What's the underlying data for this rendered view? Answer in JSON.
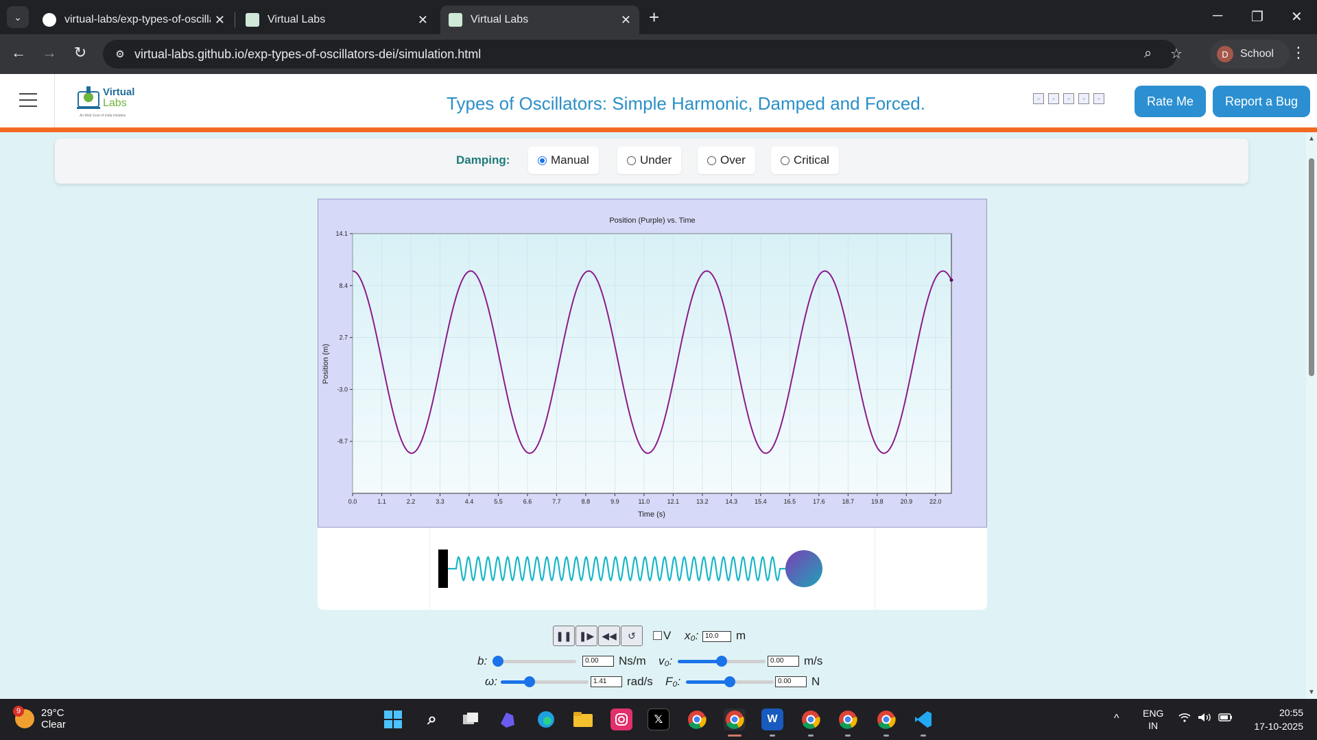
{
  "browser": {
    "tabs": [
      {
        "title": "virtual-labs/exp-types-of-oscilla",
        "favicon": "github-icon",
        "active": false
      },
      {
        "title": "Virtual Labs",
        "favicon": "virtual-labs-icon",
        "active": false
      },
      {
        "title": "Virtual Labs",
        "favicon": "virtual-labs-icon",
        "active": true
      }
    ],
    "close_glyph": "✕",
    "new_tab_glyph": "+",
    "url": "virtual-labs.github.io/exp-types-of-oscillators-dei/simulation.html",
    "profile": {
      "initial": "D",
      "label": "School"
    },
    "window_controls": [
      "─",
      "❐",
      "✕"
    ]
  },
  "header": {
    "logo_word1": "Virtual",
    "logo_word2": "Labs",
    "logo_tagline": "An MoE Govt of India Initiative",
    "title": "Types of Oscillators: Simple Harmonic, Damped and Forced.",
    "rate_button": "Rate Me",
    "bug_button": "Report a Bug"
  },
  "damping": {
    "label": "Damping:",
    "options": [
      "Manual",
      "Under",
      "Over",
      "Critical"
    ],
    "selected": "Manual"
  },
  "chart_data": {
    "type": "line",
    "title": "Position (Purple) vs. Time",
    "xlabel": "Time (s)",
    "ylabel": "Position (m)",
    "xlim": [
      0,
      22.6
    ],
    "ylim": [
      -14.4,
      14.1
    ],
    "x_ticks": [
      "0.0",
      "1.1",
      "2.2",
      "3.3",
      "4.4",
      "5.5",
      "6.6",
      "7.7",
      "8.8",
      "9.9",
      "11.0",
      "12.1",
      "13.2",
      "14.3",
      "15.4",
      "16.5",
      "17.6",
      "18.7",
      "19.8",
      "20.9",
      "22.0"
    ],
    "y_ticks": [
      {
        "label": "14.1",
        "value": 14.1
      },
      {
        "label": "8.4",
        "value": 8.4
      },
      {
        "label": "2.7",
        "value": 2.7
      },
      {
        "label": "-3.0",
        "value": -3.0
      },
      {
        "label": "-8.7",
        "value": -8.7
      }
    ],
    "series": [
      {
        "color": "#8b1a8b",
        "amplitude": 10.0,
        "omega": 1.41,
        "damping": 0.0,
        "t_end": 22.6
      }
    ],
    "grid": true
  },
  "controls": {
    "b_label": "b:",
    "b_value": "0.00",
    "b_unit": "Ns/m",
    "b_fraction": 0.0,
    "omega_label": "ω:",
    "omega_value": "1.41",
    "omega_unit": "rad/s",
    "omega_fraction": 0.3,
    "v_check_label": "V",
    "x0_label": "x₀:",
    "x0_value": "10.0",
    "x0_unit": "m",
    "v0_label": "v₀:",
    "v0_value": "0.00",
    "v0_unit": "m/s",
    "v0_fraction": 0.5,
    "f0_label": "F₀:",
    "f0_value": "0.00",
    "f0_unit": "N",
    "f0_fraction": 0.5,
    "buttons": [
      {
        "name": "pause-button",
        "glyph": "❚❚"
      },
      {
        "name": "step-button",
        "glyph": "❚▶"
      },
      {
        "name": "rewind-button",
        "glyph": "◀◀"
      },
      {
        "name": "reset-button",
        "glyph": "↺"
      }
    ]
  },
  "taskbar": {
    "weather_temp": "29°C",
    "weather_desc": "Clear",
    "weather_badge": "9",
    "lang1": "ENG",
    "lang2": "IN",
    "time": "20:55",
    "date": "17-10-2025"
  },
  "colors": {
    "accent": "#2b8fd1",
    "orange_bar": "#f26a21",
    "curve": "#8b1a8b",
    "spring": "#18b6c8"
  }
}
